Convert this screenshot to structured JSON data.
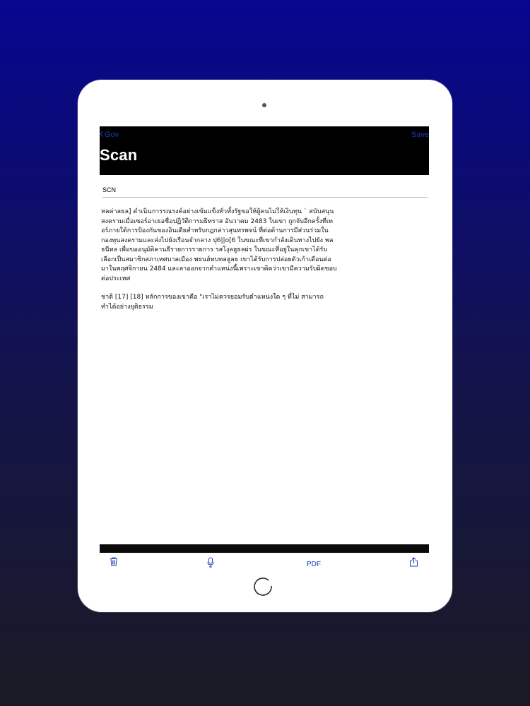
{
  "navbar": {
    "back_label": "Gov",
    "save_label": "Save",
    "title": "Scan"
  },
  "document": {
    "name_value": "SCN"
  },
  "ocr": {
    "paragraphs": [
      "หลค่าลธล] ดำเนินการรณรงค์อย่างเข้มแข็งทั่วทั้งรัฐขอให้ผู้คนไม่ให้เงินทุน ` สนับสนุนสงครามเมื่อเซอร์อาเธอชื่อปฏิวัติการมธิทราส อันวาคม 2483 ในเขา ถูกจับอีกครั้งที่เทอร์ภายใต้การป้องกันของอินเดียสำหรับกฎกล่าวสุนทรพจน์ ที่ต่อต้านการมีส่วนร่วมในกองทุนสงครามและส่งไปยังเรือนจำกลาง ปุ6||ο[6 ในขณะที่เขากำลังเดินทางไปยัง พลธนีทล เพื่อขออนุมัติคานธีรายการรายการ รสโงุลฮูธลผ่ร ในขณะที่อยู่ในคุกเขาได้รับเลือกเป็นสมาชิกสภาเทศบาลเมือง พธนฮ์ทบทลฮูลธ เขาได้รับการปล่อยตัวเก้าเดือนต่อมาในพฤศจิกายน 2484 และลาออกจากตำแหน่งนี้เพราะเขาคิดว่าเขามีความรับผิดชอบต่อประเทศ",
      "ชาติ [17] [18] หลักการของเขาคือ \"เราไม่ควรยอมรับตำแหน่งใด ๆ ที่ไม่ สามารถทำได้อย่างยุติธรรม"
    ]
  },
  "toolbar": {
    "pdf_label": "PDF"
  },
  "colors": {
    "accent": "#1a3db8",
    "navbar_bg": "#000000",
    "background_top": "#07078f",
    "background_bottom": "#1a1a24"
  },
  "icons": {
    "trash": "trash-icon",
    "mic": "microphone-icon",
    "share": "share-icon",
    "back": "chevron-left-icon"
  }
}
